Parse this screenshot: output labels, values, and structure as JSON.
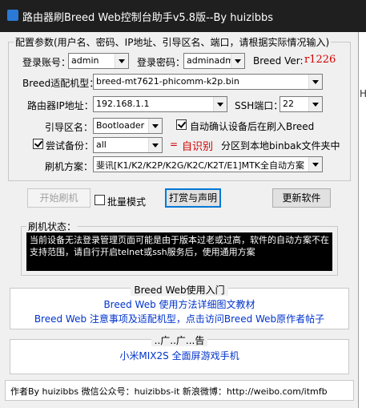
{
  "window": {
    "title": "路由器刷Breed Web控制台助手v5.8版--By huizibbs",
    "edge_fragment": "Ha"
  },
  "config": {
    "legend": "配置参数(用户名、密码、IP地址、引导区名、端口，请根据实际情况输入)",
    "login_account_label": "登录账号：",
    "login_account_value": "admin",
    "login_password_label": "登录密码：",
    "login_password_value": "adminadmin",
    "breed_ver_label": "Breed Ver:",
    "breed_ver_value": "r1226",
    "breed_model_label": "Breed适配机型：",
    "breed_model_value": "breed-mt7621-phicomm-k2p.bin",
    "router_ip_label": "路由器IP地址：",
    "router_ip_value": "192.168.1.1",
    "ssh_port_label": "SSH端口：",
    "ssh_port_value": "22",
    "boot_label": "引导区名：",
    "boot_value": "Bootloader",
    "auto_confirm_label": "自动确认设备后在刷入Breed",
    "auto_confirm_checked": true,
    "try_backup_label": "尝试备份：",
    "try_backup_checked": true,
    "try_backup_value": "all",
    "equals": "=",
    "auto_identify": "自识别",
    "backup_note": "分区到本地binbak文件夹中",
    "flash_plan_label": "刷机方案：",
    "flash_plan_value": "斐讯[K1/K2/K2P/K2G/K2C/K2T/E1]MTK全自动方案"
  },
  "actions": {
    "start_flash": "开始刷机",
    "batch_mode": "批量模式",
    "donate": "打赏与声明",
    "update": "更新软件"
  },
  "status": {
    "legend": "刷机状态：",
    "text": "当前设备无法登录管理页面可能是由于版本过老或过高，软件的自动方案不在支持范围，请自行开启telnet或ssh服务后，使用通用方案"
  },
  "breed_web": {
    "legend": "Breed Web使用入门",
    "link1": "Breed Web 使用方法详细图文教材",
    "link2": "Breed Web 注意事项及适配机型，点击访问Breed Web原作者帖子"
  },
  "ad": {
    "legend": "..广..广...告",
    "text": "小米MIX2S 全面屏游戏手机"
  },
  "footer": {
    "text": "作者By huizibbs 微信公众号：huizibbs-it 新浪微博：http://weibo.com/itmfb"
  },
  "colors": {
    "accent_red": "#d00000",
    "link_blue": "#0033cc",
    "title_bg": "#1f1f1f"
  }
}
